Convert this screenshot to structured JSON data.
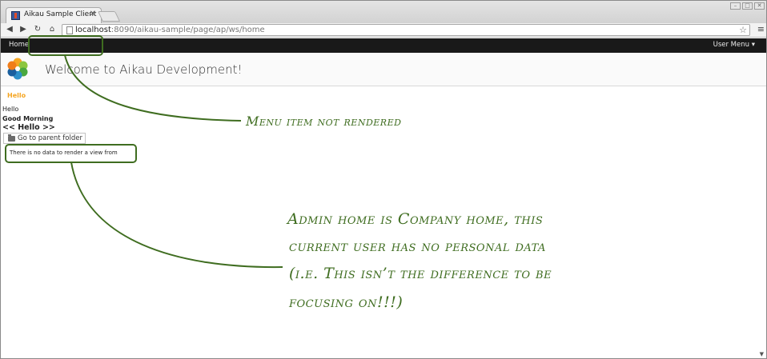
{
  "browser": {
    "tab_title": "Aikau Sample Client",
    "tab_close": "✕",
    "url_host": "localhost",
    "url_rest": ":8090/aikau-sample/page/ap/ws/home"
  },
  "app_header": {
    "home_label": "Home",
    "user_menu_label": "User Menu ▾"
  },
  "site": {
    "title": "Welcome to Aikau Development!"
  },
  "content": {
    "hello_orange": "Hello",
    "hello_plain": "Hello",
    "good_morning": "Good Morning",
    "hello_bracket": "<< Hello >>",
    "parent_folder_button": "Go to parent folder",
    "no_data_message": "There is no data to render a view from"
  },
  "annotations": {
    "note1": "Menu item not rendered",
    "note2_line1": "Admin home is Company home, this",
    "note2_line2": "current user has no personal data",
    "note2_line3": "(i.e. This isn’t the difference to be",
    "note2_line4": "focusing on!!!)"
  },
  "colors": {
    "annotation": "#3f6d20",
    "app_bar": "#191919",
    "accent_orange": "#f5a623"
  },
  "icons": {
    "back": "back-arrow-icon",
    "forward": "forward-arrow-icon",
    "reload": "reload-icon",
    "home": "home-icon",
    "bookmark": "star-icon",
    "menu": "hamburger-menu-icon",
    "folder": "folder-up-icon",
    "logo": "alfresco-flower-logo"
  }
}
